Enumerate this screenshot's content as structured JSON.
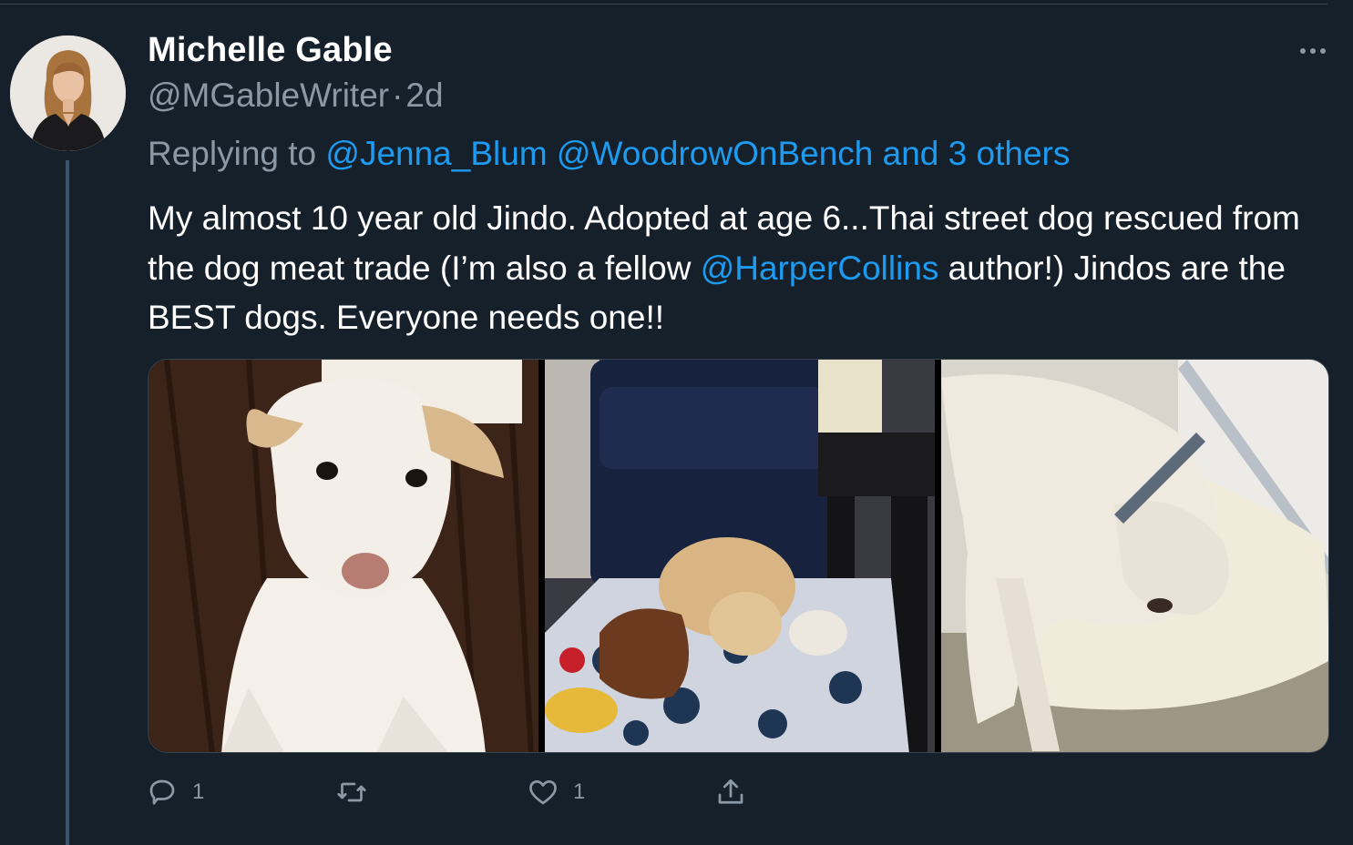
{
  "tweet": {
    "author_name": "Michelle Gable",
    "handle": "@MGableWriter",
    "separator": "·",
    "time_ago": "2d",
    "replying_prefix": "Replying to",
    "reply_mention_1": "@Jenna_Blum",
    "reply_mention_2": "@WoodrowOnBench",
    "reply_others": "and 3 others",
    "text_part1": "My almost 10 year old Jindo. Adopted at age 6...Thai street dog rescued from the dog meat trade (I’m also a fellow ",
    "text_mention": "@HarperCollins",
    "text_part2": " author!) Jindos are the BEST dogs. Everyone needs one!!"
  },
  "actions": {
    "reply_count": "1",
    "retweet_count": "",
    "like_count": "1"
  },
  "icons": {
    "more": "more-horizontal-icon",
    "reply": "reply-bubble-icon",
    "retweet": "retweet-icon",
    "like": "heart-icon",
    "share": "share-upload-icon"
  },
  "colors": {
    "background": "#15202b",
    "link": "#1d9bf0",
    "secondary_text": "#8b98a5",
    "divider": "#38444d"
  }
}
